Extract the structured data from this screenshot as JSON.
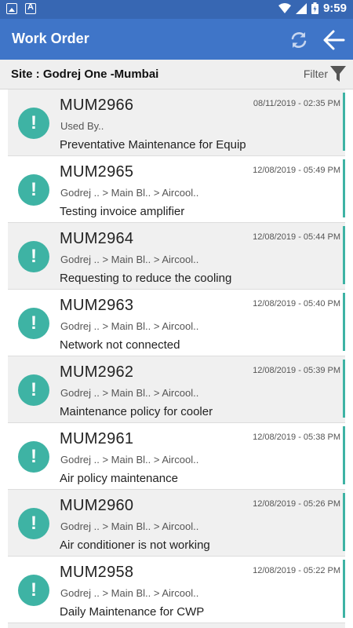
{
  "status_bar": {
    "time": "9:59",
    "left_icons": [
      "image-icon",
      "a-icon"
    ],
    "right_icons": [
      "wifi-icon",
      "signal-icon",
      "battery-icon"
    ]
  },
  "app_bar": {
    "title": "Work Order",
    "refresh_icon": "refresh-icon",
    "back_icon": "arrow-left-icon",
    "background": "#3f75c8"
  },
  "site": {
    "label_prefix": "Site : ",
    "name": "Godrej One -Mumbai",
    "filter_label": "Filter",
    "filter_icon": "funnel-icon"
  },
  "accent_color": "#3eb3a4",
  "work_orders": [
    {
      "id": "MUM2966",
      "date": "08/11/2019 - 02:35 PM",
      "location": "Used By..",
      "description": "Preventative Maintenance for Equip"
    },
    {
      "id": "MUM2965",
      "date": "12/08/2019 - 05:49 PM",
      "location": "Godrej .. > Main Bl.. > Aircool..",
      "description": "Testing invoice amplifier"
    },
    {
      "id": "MUM2964",
      "date": "12/08/2019 - 05:44 PM",
      "location": "Godrej .. > Main Bl.. > Aircool..",
      "description": "Requesting to reduce the cooling"
    },
    {
      "id": "MUM2963",
      "date": "12/08/2019 - 05:40 PM",
      "location": "Godrej .. > Main Bl.. > Aircool..",
      "description": "Network not connected"
    },
    {
      "id": "MUM2962",
      "date": "12/08/2019 - 05:39 PM",
      "location": "Godrej .. > Main Bl.. > Aircool..",
      "description": "Maintenance policy for cooler"
    },
    {
      "id": "MUM2961",
      "date": "12/08/2019 - 05:38 PM",
      "location": "Godrej .. > Main Bl.. > Aircool..",
      "description": "Air policy maintenance"
    },
    {
      "id": "MUM2960",
      "date": "12/08/2019 - 05:26 PM",
      "location": "Godrej .. > Main Bl.. > Aircool..",
      "description": "Air conditioner is not working"
    },
    {
      "id": "MUM2958",
      "date": "12/08/2019 - 05:22 PM",
      "location": "Godrej .. > Main Bl.. > Aircool..",
      "description": "Daily Maintenance for CWP"
    }
  ]
}
